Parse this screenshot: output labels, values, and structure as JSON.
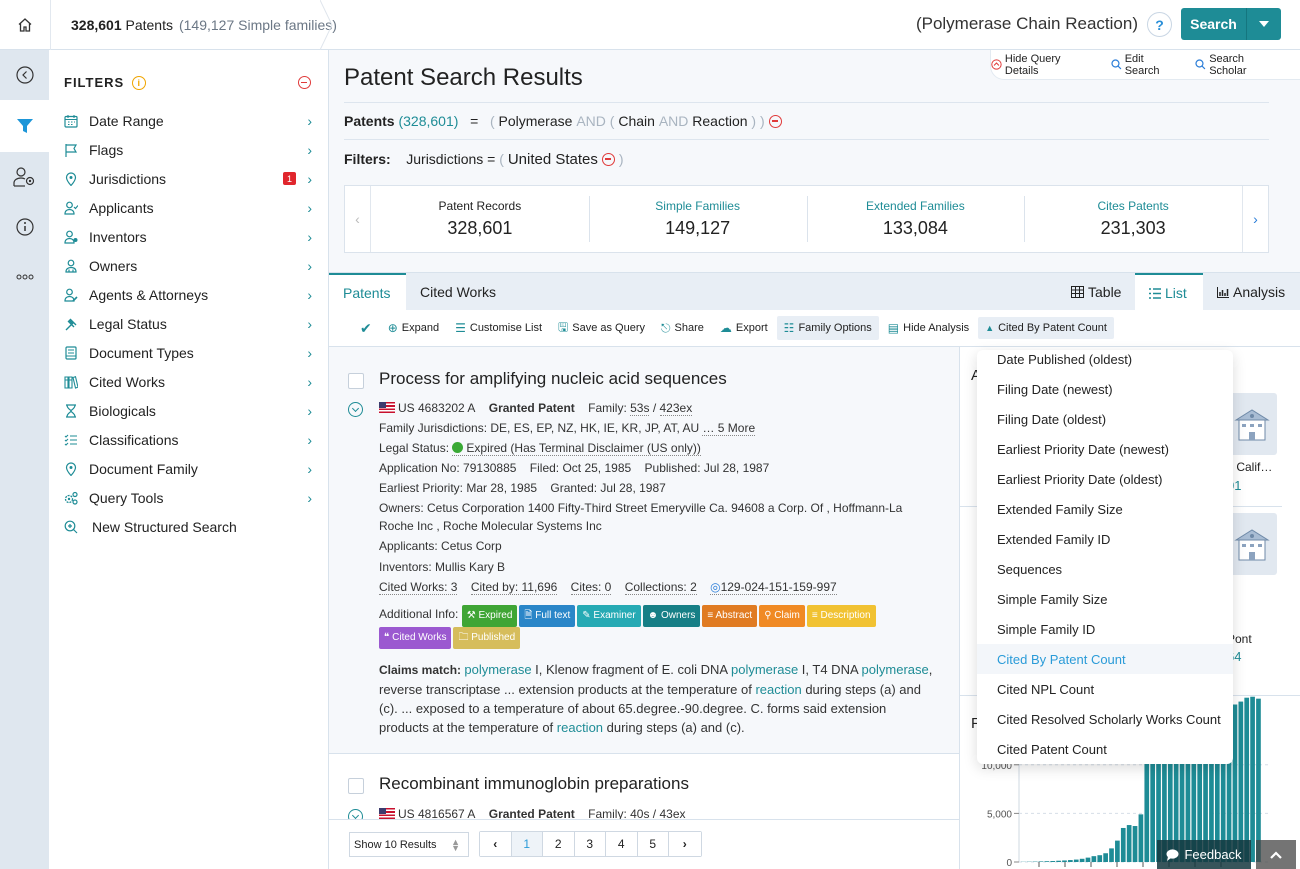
{
  "topbar": {
    "patent_count": "328,601",
    "patents_label": "Patents",
    "families_note": "(149,127 Simple families)",
    "query_title": "(Polymerase Chain Reaction)",
    "help_label": "?",
    "search_label": "Search"
  },
  "rail": {
    "items": [
      {
        "icon": "collapse-icon"
      },
      {
        "icon": "filter-icon"
      },
      {
        "icon": "user-settings-icon"
      },
      {
        "icon": "info-icon"
      },
      {
        "icon": "more-icon"
      }
    ]
  },
  "filters": {
    "heading": "FILTERS",
    "items": [
      {
        "label": "Date Range",
        "icon": "calendar-icon"
      },
      {
        "label": "Flags",
        "icon": "flag-icon"
      },
      {
        "label": "Jurisdictions",
        "icon": "location-pin-icon",
        "badge": "1"
      },
      {
        "label": "Applicants",
        "icon": "user-check-icon"
      },
      {
        "label": "Inventors",
        "icon": "user-gear-icon"
      },
      {
        "label": "Owners",
        "icon": "users-icon"
      },
      {
        "label": "Agents & Attorneys",
        "icon": "user-edit-icon"
      },
      {
        "label": "Legal Status",
        "icon": "gavel-icon"
      },
      {
        "label": "Document Types",
        "icon": "document-icon"
      },
      {
        "label": "Cited Works",
        "icon": "library-icon"
      },
      {
        "label": "Biologicals",
        "icon": "hourglass-icon"
      },
      {
        "label": "Classifications",
        "icon": "list-check-icon"
      },
      {
        "label": "Document Family",
        "icon": "location-pin-icon"
      },
      {
        "label": "Query Tools",
        "icon": "gears-icon"
      },
      {
        "label": "New Structured Search",
        "icon": "zoom-plus-icon"
      }
    ]
  },
  "main": {
    "title": "Patent Search Results",
    "query_links": [
      "Hide Query Details",
      "Edit Search",
      "Search Scholar"
    ],
    "query": {
      "label": "Patents",
      "count": "(328,601)",
      "eq": "=",
      "open1": "(",
      "term1": "Polymerase",
      "op1": "AND",
      "open2": "(",
      "term2": "Chain",
      "op2": "AND",
      "term3": "Reaction",
      "close": ") )"
    },
    "filter_line": {
      "label": "Filters:",
      "field": "Jurisdictions",
      "eq": "=",
      "open": "(",
      "value": "United States",
      "close": ")"
    },
    "stats": [
      {
        "label": "Patent Records",
        "value": "328,601"
      },
      {
        "label": "Simple Families",
        "value": "149,127"
      },
      {
        "label": "Extended Families",
        "value": "133,084"
      },
      {
        "label": "Cites Patents",
        "value": "231,303"
      }
    ],
    "tabs": [
      "Patents",
      "Cited Works"
    ],
    "views": [
      "Table",
      "List",
      "Analysis"
    ],
    "toolbar": [
      "Expand",
      "Customise List",
      "Save as Query",
      "Share",
      "Export",
      "Family Options",
      "Hide Analysis",
      "Cited By Patent Count"
    ]
  },
  "results": [
    {
      "title": "Process for amplifying nucleic acid sequences",
      "number": "US 4683202 A",
      "type": "Granted Patent",
      "family_label": "Family:",
      "family_s": "53s",
      "family_ex": "423ex",
      "jurisdictions_label": "Family Jurisdictions:",
      "jurisdictions": "DE, ES, EP, NZ, HK, IE, KR, JP, AT, AU",
      "more": "… 5 More",
      "legal_label": "Legal Status:",
      "legal": "Expired (Has Terminal Disclaimer (US only))",
      "application": "Application No: 79130885",
      "filed": "Filed: Oct 25, 1985",
      "published": "Published: Jul 28, 1987",
      "priority": "Earliest Priority: Mar 28, 1985",
      "granted": "Granted: Jul 28, 1987",
      "owners_1": "Owners: Cetus Corporation 1400 Fifty-Third Street Emeryville Ca. 94608 a Corp. Of , Hoffmann-La",
      "owners_2": "Roche Inc , Roche Molecular Systems Inc",
      "applicants": "Applicants: Cetus Corp",
      "inventors": "Inventors: Mullis Kary B",
      "cited_works": "Cited Works: 3",
      "cited_by": "Cited by: 11,696",
      "cites": "Cites: 0",
      "collections": "Collections: 2",
      "lens_id": "129-024-151-159-997",
      "additional_label": "Additional Info:",
      "tags": [
        {
          "label": "Expired",
          "color": "#3fa535"
        },
        {
          "label": "Full text",
          "color": "#2a86c8"
        },
        {
          "label": "Examiner",
          "color": "#26aab4"
        },
        {
          "label": "Owners",
          "color": "#177f86"
        },
        {
          "label": "Abstract",
          "color": "#e07b22"
        },
        {
          "label": "Claim",
          "color": "#f08a24"
        },
        {
          "label": "Description",
          "color": "#f1c232"
        },
        {
          "label": "Cited Works",
          "color": "#9b59d0"
        },
        {
          "label": "Published",
          "color": "#d6bd5c"
        }
      ],
      "claims_label": "Claims match:",
      "claims": [
        {
          "t": "polymerase",
          "h": true
        },
        {
          "t": " I, Klenow fragment of E. coli DNA ",
          "h": false
        },
        {
          "t": "polymerase",
          "h": true
        },
        {
          "t": " I, T4 DNA ",
          "h": false
        },
        {
          "t": "polymerase",
          "h": true
        },
        {
          "t": ", reverse transcriptase ... extension products at the temperature of ",
          "h": false
        },
        {
          "t": "reaction",
          "h": true
        },
        {
          "t": " during steps (a) and (c). ... exposed to a temperature of about 65.degree.-90.degree. C. forms said extension products at the temperature of ",
          "h": false
        },
        {
          "t": "reaction",
          "h": true
        },
        {
          "t": " during steps (a) and (c).",
          "h": false
        }
      ]
    },
    {
      "title": "Recombinant immunoglobin preparations",
      "number": "US 4816567 A",
      "type": "Granted Patent",
      "family_label": "Family:",
      "family": "40s / 43ex"
    }
  ],
  "pager": {
    "show": "Show 10 Results",
    "pages": [
      "1",
      "2",
      "3",
      "4",
      "5"
    ],
    "current": "1"
  },
  "analysis": {
    "heading_initial": "A",
    "chart_heading_initial": "F",
    "cards": [
      {
        "name": "v Calif…",
        "value": "01"
      },
      {
        "name": "Pont",
        "value": "64"
      }
    ]
  },
  "sort_dropdown": {
    "items": [
      "Date Published (oldest)",
      "Filing Date (newest)",
      "Filing Date (oldest)",
      "Earliest Priority Date (newest)",
      "Earliest Priority Date (oldest)",
      "Extended Family Size",
      "Extended Family ID",
      "Sequences",
      "Simple Family Size",
      "Simple Family ID",
      "Cited By Patent Count",
      "Cited NPL Count",
      "Cited Resolved Scholarly Works Count",
      "Cited Patent Count"
    ],
    "selected": "Cited By Patent Count"
  },
  "chart_data": {
    "type": "bar",
    "title": "",
    "ylabel": "",
    "ylim": [
      0,
      18000
    ],
    "yticks": [
      "0",
      "5,000",
      "10,000"
    ],
    "values": [
      20,
      30,
      40,
      60,
      80,
      100,
      130,
      160,
      200,
      250,
      330,
      450,
      600,
      700,
      900,
      1400,
      2200,
      3500,
      3800,
      3700,
      4900,
      10200,
      11000,
      11500,
      11800,
      12000,
      12200,
      12300,
      12500,
      12600,
      12700,
      12800,
      12900,
      13000,
      14200,
      14600,
      16200,
      16500,
      16900,
      17000,
      16800
    ],
    "color": "#1e8c96"
  },
  "feedback": {
    "label": "Feedback"
  },
  "colors": {
    "accent": "#1e8c96",
    "danger": "#e03a3a",
    "link": "#2a9bd8"
  }
}
